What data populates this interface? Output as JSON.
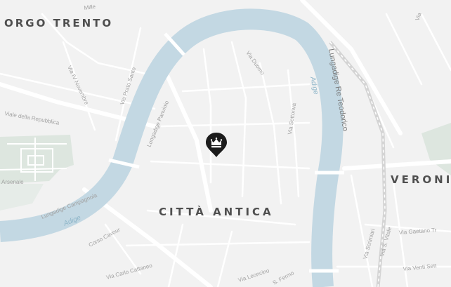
{
  "map": {
    "colors": {
      "background": "#f2f2f2",
      "water": "#c3d8e3",
      "park": "#dde6df",
      "roads": "#ffffff",
      "railway": "#d4d4d4",
      "district_text": "#4f4f4f",
      "street_text": "#a2a2a2",
      "marker_fill": "#1c1c1c"
    },
    "districts": {
      "borgo_trento": "ORGO TRENTO",
      "citta_antica": "CITTÀ ANTICA",
      "verona": "VERONI"
    },
    "streets": {
      "mille": "Mille",
      "iv_novembre": "Via IV Novembre",
      "prato_santo": "Via Prato Santo",
      "lungadige_panvinio": "Lungadige Panvinio",
      "viale_repubblica": "Viale della Repubblica",
      "arsenale": "Arsenale",
      "lungadige_campagnola": "Lungadige Campagnola",
      "corso_cavour": "Corso Cavour",
      "carlo_cattaneo": "Via Carlo Cattaneo",
      "leoncino": "Via Leoncino",
      "s_fermo": "S. Fermo",
      "duomo": "Via Duomo",
      "sottoriva": "Via Sottoriva",
      "lungadige_re_teodorico": "Lungadige Re Teodorico",
      "scrimiari": "Via Scrimiari",
      "s_vitale": "Via S. Vitale",
      "gaetano": "Via Gaetano Tr",
      "venti_settembre": "Via Venti Sett",
      "top_right": "Via"
    },
    "river_labels": {
      "east": "Adige",
      "west": "Adige"
    },
    "marker": {
      "icon": "crown-icon",
      "label": "Verona attraction marker"
    }
  }
}
